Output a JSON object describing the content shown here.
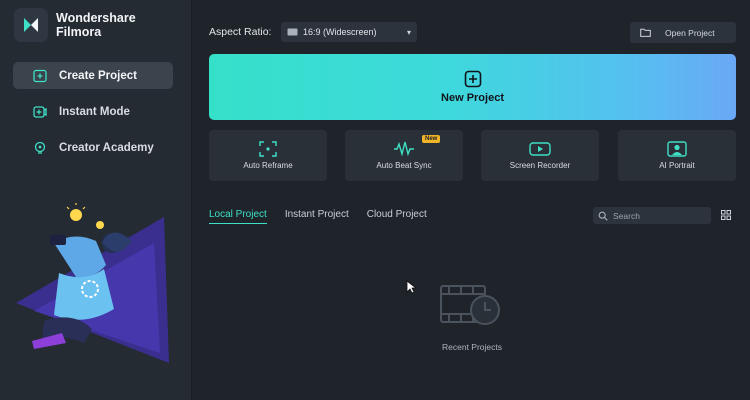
{
  "brand": {
    "line1": "Wondershare",
    "line2": "Filmora"
  },
  "sidebar": {
    "items": [
      {
        "label": "Create Project",
        "icon": "create-project-icon",
        "active": true
      },
      {
        "label": "Instant Mode",
        "icon": "instant-mode-icon",
        "active": false
      },
      {
        "label": "Creator Academy",
        "icon": "creator-academy-icon",
        "active": false
      }
    ]
  },
  "toolbar": {
    "aspect_label": "Aspect Ratio:",
    "aspect_value": "16:9 (Widescreen)",
    "open_project_label": "Open Project"
  },
  "hero": {
    "label": "New Project"
  },
  "tools": [
    {
      "label": "Auto Reframe",
      "icon": "auto-reframe-icon"
    },
    {
      "label": "Auto Beat Sync",
      "icon": "beat-sync-icon",
      "badge": "New"
    },
    {
      "label": "Screen Recorder",
      "icon": "screen-recorder-icon"
    },
    {
      "label": "AI Portrait",
      "icon": "ai-portrait-icon"
    }
  ],
  "tabs": [
    {
      "label": "Local Project",
      "active": true
    },
    {
      "label": "Instant Project",
      "active": false
    },
    {
      "label": "Cloud Project",
      "active": false
    }
  ],
  "search": {
    "placeholder": "Search"
  },
  "empty": {
    "label": "Recent Projects"
  },
  "colors": {
    "accent": "#3ee0c6",
    "badge": "#f0b429",
    "background": "#1f242b",
    "sidebar": "#252b33"
  }
}
